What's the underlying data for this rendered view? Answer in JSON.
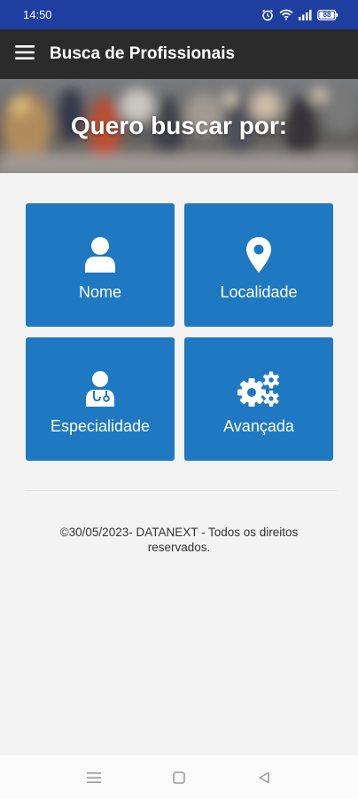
{
  "status_bar": {
    "time": "14:50",
    "battery": "88"
  },
  "app_bar": {
    "title": "Busca de Profissionais",
    "menu_icon": "hamburger-menu-icon"
  },
  "hero": {
    "title": "Quero buscar por:"
  },
  "tiles": [
    {
      "label": "Nome",
      "icon": "user-icon"
    },
    {
      "label": "Localidade",
      "icon": "map-marker-icon"
    },
    {
      "label": "Especialidade",
      "icon": "doctor-icon"
    },
    {
      "label": "Avançada",
      "icon": "gears-icon"
    }
  ],
  "footer": {
    "text": "©30/05/2023- DATANEXT - Todos os direitos reservados."
  },
  "colors": {
    "status_bar": "#1f3fa0",
    "app_bar": "#2b2b2b",
    "tile": "#1f78c2",
    "background": "#f3f3f4"
  }
}
